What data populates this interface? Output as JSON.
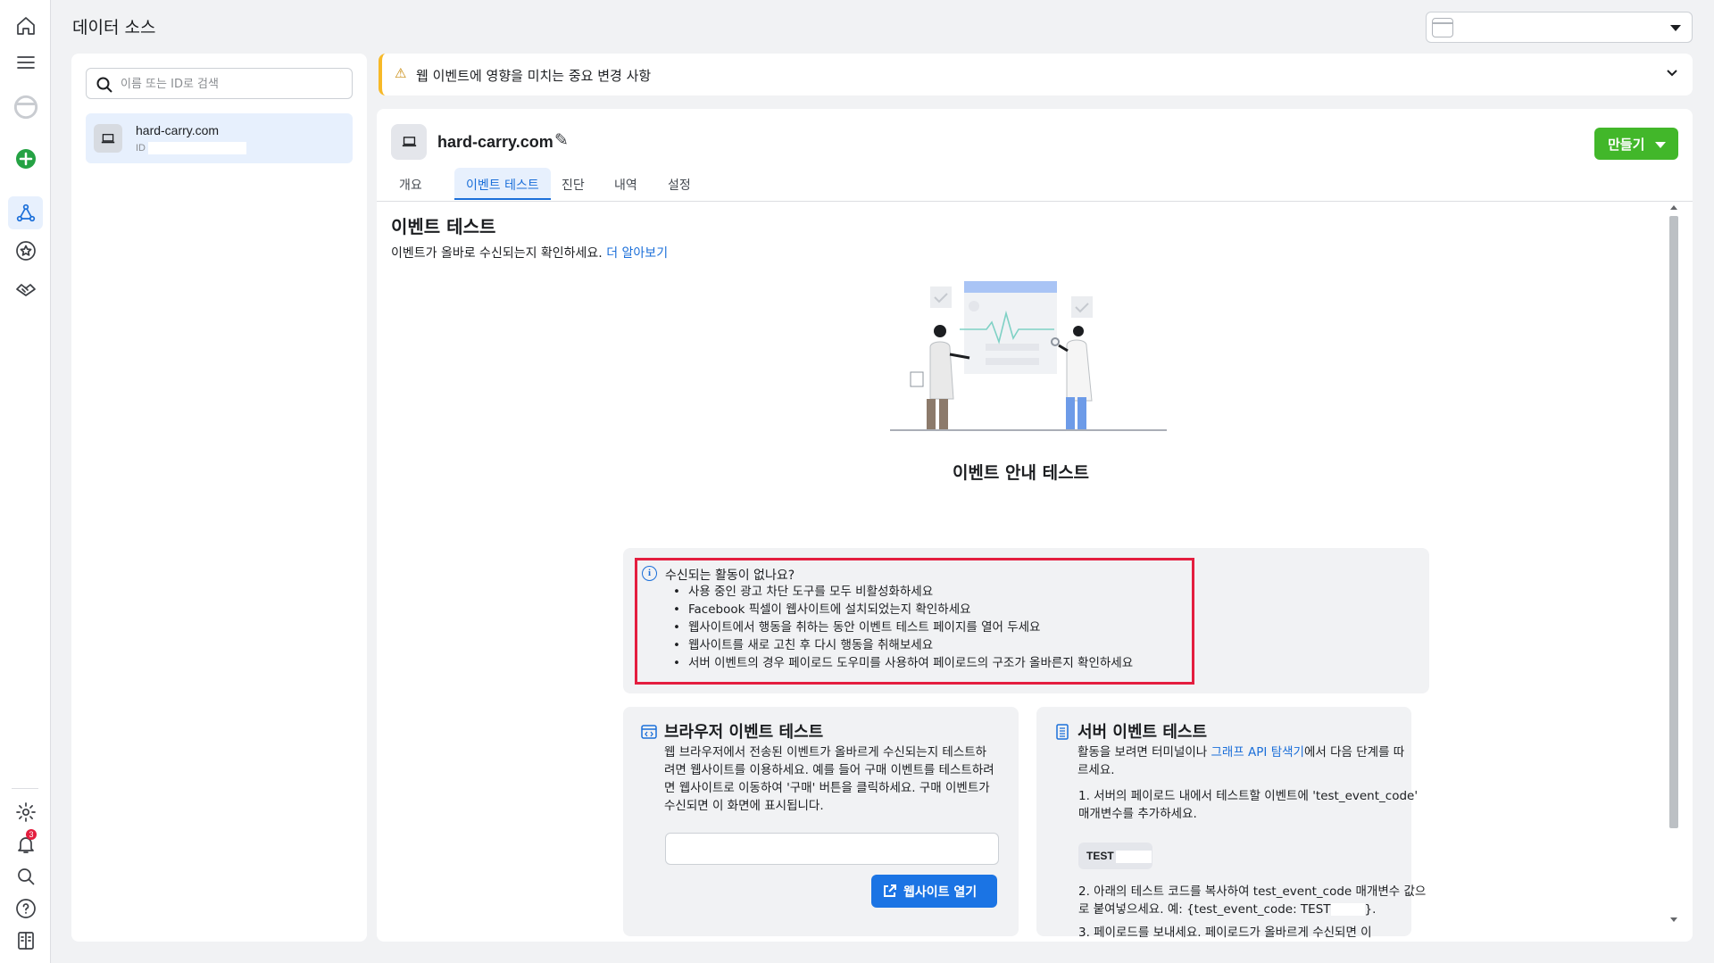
{
  "header": {
    "title": "데이터 소스"
  },
  "sidebar": {
    "notification_count": "3"
  },
  "source_list": {
    "search_placeholder": "이름 또는 ID로 검색",
    "items": [
      {
        "name": "hard-carry.com",
        "id_label": "ID"
      }
    ]
  },
  "notice": {
    "text": "웹 이벤트에 영향을 미치는 중요 변경 사항"
  },
  "detail": {
    "name": "hard-carry.com",
    "create_label": "만들기",
    "tabs": [
      "개요",
      "이벤트 테스트",
      "진단",
      "내역",
      "설정"
    ],
    "active_tab": "이벤트 테스트"
  },
  "test_events": {
    "title": "이벤트 테스트",
    "subtitle": "이벤트가 올바로 수신되는지 확인하세요.",
    "learn_more": "더 알아보기",
    "guide_title": "이벤트 안내 테스트",
    "tips_question": "수신되는 활동이 없나요?",
    "tips": [
      "사용 중인 광고 차단 도구를 모두 비활성화하세요",
      "Facebook 픽셀이 웹사이트에 설치되었는지 확인하세요",
      "웹사이트에서 행동을 취하는 동안 이벤트 테스트 페이지를 열어 두세요",
      "웹사이트를 새로 고친 후 다시 행동을 취해보세요",
      "서버 이벤트의 경우 페이로드 도우미를 사용하여 페이로드의 구조가 올바른지 확인하세요"
    ]
  },
  "browser_card": {
    "title": "브라우저 이벤트 테스트",
    "description": "웹 브라우저에서 전송된 이벤트가 올바르게 수신되는지 테스트하려면 웹사이트를 이용하세요. 예를 들어 구매 이벤트를 테스트하려면 웹사이트로 이동하여 '구매' 버튼을 클릭하세요. 구매 이벤트가 수신되면 이 화면에 표시됩니다.",
    "url_value": "",
    "button_label": "웹사이트 열기"
  },
  "server_card": {
    "title": "서버 이벤트 테스트",
    "desc_prefix": "활동을 보려면 터미널이나 ",
    "desc_link": "그래프 API 탐색기",
    "desc_suffix": "에서 다음 단계를 따르세요.",
    "step1": "1. 서버의 페이로드 내에서 테스트할 이벤트에 'test_event_code' 매개변수를 추가하세요.",
    "code": "TEST",
    "step2": "2. 아래의 테스트 코드를 복사하여 test_event_code 매개변수 값으로 붙여넣으세요. 예: {test_event_code: TEST",
    "step2_end": "}.",
    "step3": "3. 페이로드를 보내세요. 페이로드가 올바르게 수신되면 이"
  }
}
